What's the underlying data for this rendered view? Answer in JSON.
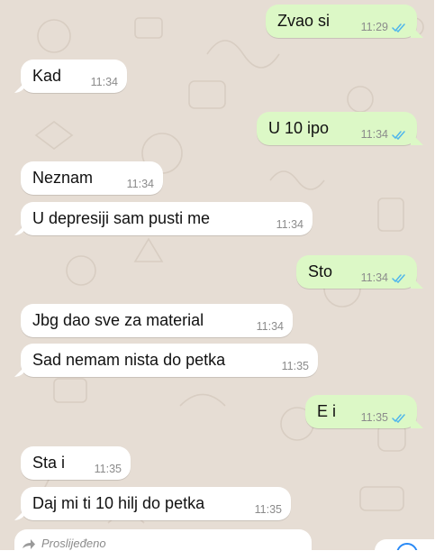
{
  "chat": {
    "messages": [
      {
        "dir": "out",
        "text": "Zvao si",
        "time": "11:29",
        "read": true
      },
      {
        "dir": "in",
        "text": "Kad",
        "time": "11:34"
      },
      {
        "dir": "out",
        "text": "U 10 ipo",
        "time": "11:34",
        "read": true
      },
      {
        "dir": "in",
        "text": "Neznam",
        "time": "11:34"
      },
      {
        "dir": "in",
        "text": "U depresiji sam pusti me",
        "time": "11:34"
      },
      {
        "dir": "out",
        "text": "Sto",
        "time": "11:34",
        "read": true
      },
      {
        "dir": "in",
        "text": "Jbg dao sve za material",
        "time": "11:34"
      },
      {
        "dir": "in",
        "text": "Sad nemam nista do petka",
        "time": "11:35"
      },
      {
        "dir": "out",
        "text": "E i",
        "time": "11:35",
        "read": true
      },
      {
        "dir": "in",
        "text": "Sta i",
        "time": "11:35"
      },
      {
        "dir": "in",
        "text": "Daj mi ti 10 hilj do petka",
        "time": "11:35"
      }
    ],
    "forwarded_label": "Proslijeđeno"
  },
  "colors": {
    "background": "#e6ddd4",
    "incoming_bubble": "#ffffff",
    "outgoing_bubble": "#dcf8c6",
    "read_ticks": "#4fb6ec",
    "time_text": "#8b8b8b"
  }
}
